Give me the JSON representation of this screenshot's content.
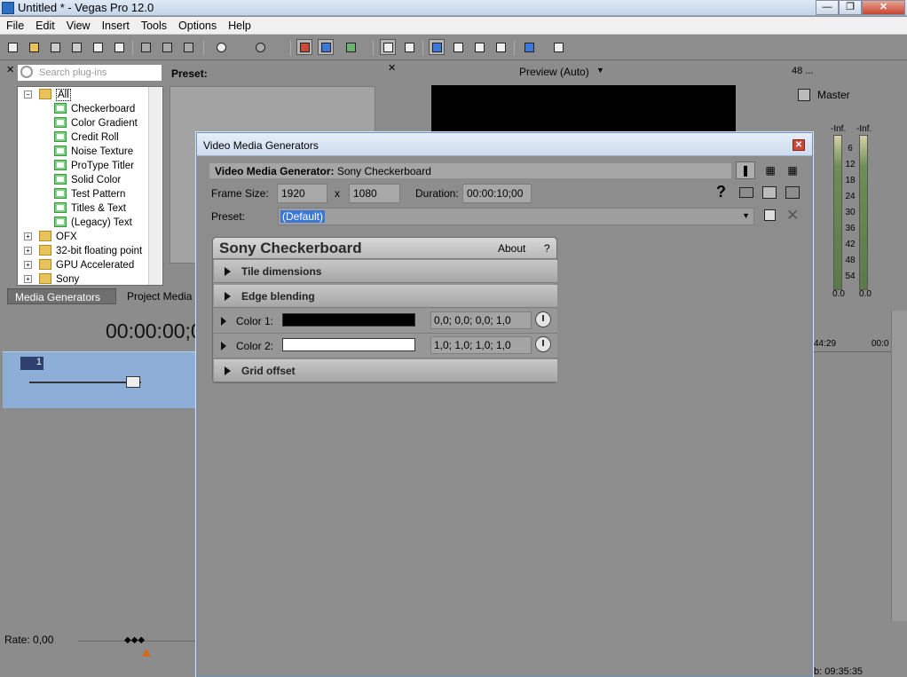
{
  "window": {
    "title": "Untitled * - Vegas Pro 12.0",
    "min": "—",
    "max": "❐",
    "close": "✕"
  },
  "menu": [
    "File",
    "Edit",
    "View",
    "Insert",
    "Tools",
    "Options",
    "Help"
  ],
  "plugins": {
    "search_placeholder": "Search plug-ins",
    "preset_label": "Preset:",
    "tree": [
      {
        "label": "All",
        "level": 0,
        "kind": "folder",
        "expander": "−",
        "selected": true
      },
      {
        "label": "Checkerboard",
        "level": 1,
        "kind": "gen"
      },
      {
        "label": "Color Gradient",
        "level": 1,
        "kind": "gen"
      },
      {
        "label": "Credit Roll",
        "level": 1,
        "kind": "gen"
      },
      {
        "label": "Noise Texture",
        "level": 1,
        "kind": "gen"
      },
      {
        "label": "ProType Titler",
        "level": 1,
        "kind": "gen"
      },
      {
        "label": "Solid Color",
        "level": 1,
        "kind": "gen"
      },
      {
        "label": "Test Pattern",
        "level": 1,
        "kind": "gen"
      },
      {
        "label": "Titles & Text",
        "level": 1,
        "kind": "gen"
      },
      {
        "label": "(Legacy) Text",
        "level": 1,
        "kind": "gen"
      },
      {
        "label": "OFX",
        "level": 0,
        "kind": "folder",
        "expander": "+"
      },
      {
        "label": "32-bit floating point",
        "level": 0,
        "kind": "folder",
        "expander": "+"
      },
      {
        "label": "GPU Accelerated",
        "level": 0,
        "kind": "folder",
        "expander": "+"
      },
      {
        "label": "Sony",
        "level": 0,
        "kind": "folder",
        "expander": "+"
      }
    ],
    "tabs": [
      "Media Generators",
      "Project Media"
    ]
  },
  "preview": {
    "mode": "Preview (Auto)"
  },
  "master": {
    "zoom": "48 ...",
    "title": "Master",
    "inf_left": "-Inf.",
    "inf_right": "-Inf.",
    "ticks": [
      "6",
      "12",
      "18",
      "24",
      "30",
      "36",
      "42",
      "48",
      "54"
    ],
    "bottom_left": "0.0",
    "bottom_right": "0.0"
  },
  "timeline": {
    "timecode": "00:00:00;0",
    "track_number": "1",
    "ruler_a": "44:29",
    "ruler_b": "00:0",
    "rate": "Rate: 0,00",
    "end_time": "b: 09:35:35"
  },
  "dialog": {
    "title": "Video Media Generators",
    "close": "✕",
    "generator_label": "Video Media Generator:",
    "generator_name": "Sony Checkerboard",
    "frame_size_label": "Frame Size:",
    "frame_w": "1920",
    "frame_x": "x",
    "frame_h": "1080",
    "duration_label": "Duration:",
    "duration": "00:00:10;00",
    "help": "?",
    "preset_label": "Preset:",
    "preset_value": "(Default)",
    "card": {
      "title": "Sony Checkerboard",
      "about": "About",
      "help": "?",
      "sections": [
        "Tile dimensions",
        "Edge blending"
      ],
      "colors": [
        {
          "label": "Color 1:",
          "value": "0,0; 0,0; 0,0; 1,0",
          "swatch": "#000000"
        },
        {
          "label": "Color 2:",
          "value": "1,0; 1,0; 1,0; 1,0",
          "swatch": "#ffffff"
        }
      ],
      "last_section": "Grid offset"
    }
  },
  "colors": {
    "selection": "#3b78d8",
    "track": "#8daed6",
    "dialog_border": "#6f8fb8"
  }
}
